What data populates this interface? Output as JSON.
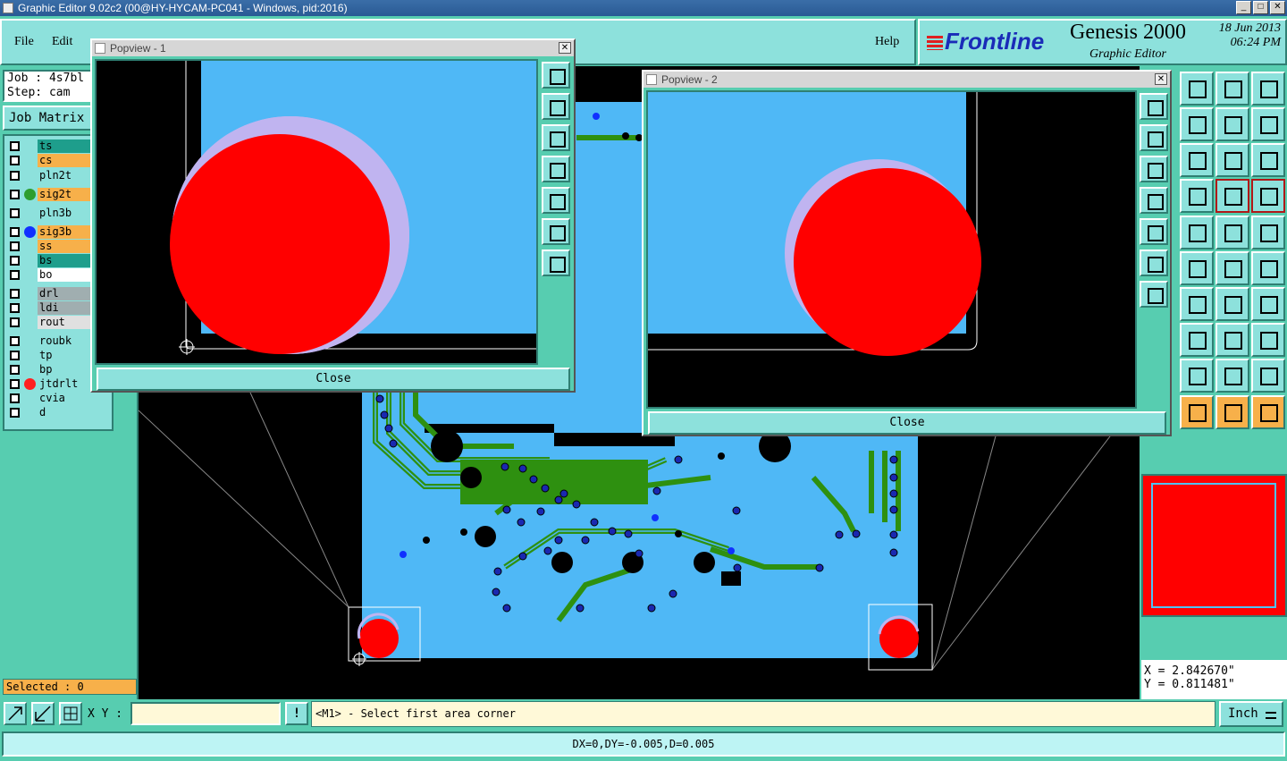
{
  "window": {
    "title": "Graphic Editor 9.02c2 (00@HY-HYCAM-PC041 - Windows, pid:2016)",
    "min": "_",
    "max": "□",
    "close": "✕"
  },
  "menu": {
    "file": "File",
    "edit": "Edit",
    "help": "Help"
  },
  "brand": {
    "logo": "Frontline",
    "product": "Genesis 2000",
    "subtitle": "Graphic Editor",
    "date": "18 Jun 2013",
    "time": "06:24 PM"
  },
  "job": {
    "job_label": "Job : 4s7bl",
    "step_label": "Step: cam",
    "matrix_button": "Job Matrix"
  },
  "layers": [
    {
      "name": "ts",
      "color": "#1e9e8c",
      "dot": ""
    },
    {
      "name": "cs",
      "color": "#f7b04a",
      "dot": ""
    },
    {
      "name": "pln2t",
      "color": "#8de1dc",
      "dot": ""
    },
    {
      "name": "sig2t",
      "color": "#f7b04a",
      "dot": "#2e9e2e"
    },
    {
      "name": "pln3b",
      "color": "#8de1dc",
      "dot": ""
    },
    {
      "name": "sig3b",
      "color": "#f7b04a",
      "dot": "#1030ff"
    },
    {
      "name": "ss",
      "color": "#f7b04a",
      "dot": ""
    },
    {
      "name": "bs",
      "color": "#1e9e8c",
      "dot": ""
    },
    {
      "name": "bo",
      "color": "#ffffff",
      "dot": ""
    },
    {
      "name": "drl",
      "color": "#a0aeb0",
      "dot": ""
    },
    {
      "name": "ldi",
      "color": "#a0aeb0",
      "dot": ""
    },
    {
      "name": "rout",
      "color": "#e0e0e0",
      "dot": ""
    },
    {
      "name": "roubk",
      "color": "#8de1dc",
      "dot": ""
    },
    {
      "name": "tp",
      "color": "#8de1dc",
      "dot": ""
    },
    {
      "name": "bp",
      "color": "#8de1dc",
      "dot": ""
    },
    {
      "name": "jtdrlt",
      "color": "#8de1dc",
      "dot": "#ff2020"
    },
    {
      "name": "cvia",
      "color": "#8de1dc",
      "dot": ""
    },
    {
      "name": "d",
      "color": "#8de1dc",
      "dot": ""
    }
  ],
  "selected_label": "Selected : 0",
  "popview1": {
    "title": "Popview - 1",
    "close_label": "Close",
    "close_x": "✕"
  },
  "popview2": {
    "title": "Popview - 2",
    "close_label": "Close",
    "close_x": "✕"
  },
  "coords": {
    "x": "X = 2.842670\"",
    "y": "Y = 0.811481\""
  },
  "command": {
    "xy_label": "X Y :",
    "xy_value": "",
    "bang": "!",
    "prompt": "<M1> - Select first area corner",
    "unit": "Inch"
  },
  "status": "DX=0,DY=-0.005,D=0.005",
  "colors": {
    "board": "#4fb8f6",
    "pad": "#ff0000",
    "copper": "#2e9010",
    "via": "#1a28b0",
    "highlight": "#c0b4f0"
  }
}
